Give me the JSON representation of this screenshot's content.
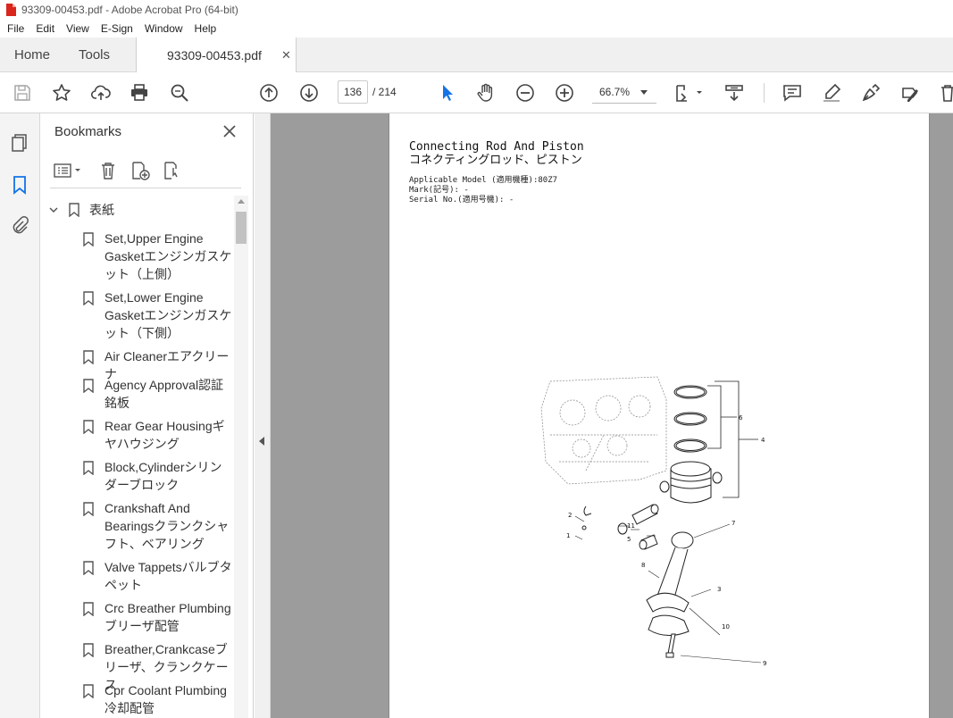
{
  "window": {
    "title": "93309-00453.pdf - Adobe Acrobat Pro (64-bit)"
  },
  "menu": [
    "File",
    "Edit",
    "View",
    "E-Sign",
    "Window",
    "Help"
  ],
  "tabs": {
    "home": "Home",
    "tools": "Tools",
    "document": "93309-00453.pdf"
  },
  "toolbar": {
    "current_page": "136",
    "total_pages": "/ 214",
    "zoom": "66.7%"
  },
  "bookmarks": {
    "header": "Bookmarks",
    "root": "表紙",
    "items": [
      "Set,Upper Engine Gasketエンジンガスケット（上側）",
      "Set,Lower Engine Gasketエンジンガスケット（下側）",
      "Air Cleanerエアクリーナ",
      "Agency Approval認証銘板",
      "Rear Gear Housingギヤハウジング",
      "Block,Cylinderシリンダーブロック",
      "Crankshaft And Bearingsクランクシャフト、ベアリング",
      "Valve Tappetsバルブタペット",
      "Crc Breather Plumbingブリーザ配管",
      "Breather,Crankcaseブリーザ、クランクケース",
      "Cpr Coolant Plumbing冷却配管"
    ]
  },
  "page": {
    "title_en": "Connecting Rod And Piston",
    "title_jp": "コネクティングロッド、ピストン",
    "meta": [
      "Applicable Model (適用機種):80Z7",
      "Mark(記号): -",
      "Serial No.(適用号機): -"
    ],
    "callouts": [
      "1",
      "2",
      "3",
      "4",
      "5",
      "6",
      "7",
      "8",
      "9",
      "10",
      "11"
    ],
    "figure_id": "pp680gx"
  },
  "colors": {
    "accent": "#1473e6",
    "tab_bg": "#f0f0f0",
    "doc_bg": "#9c9c9c"
  }
}
